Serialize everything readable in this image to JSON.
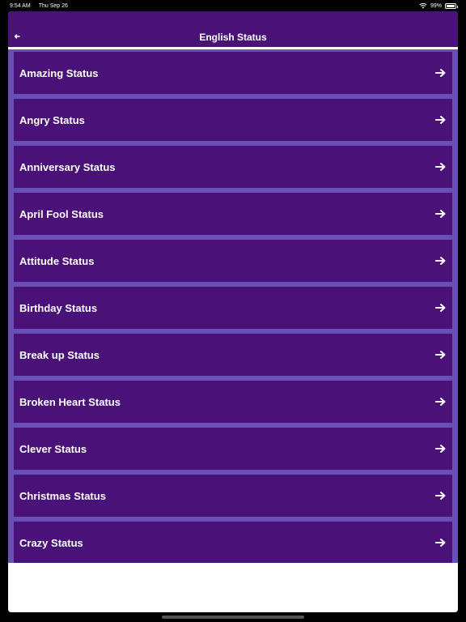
{
  "status_bar": {
    "time": "9:54 AM",
    "date": "Thu Sep 26",
    "battery": "99%"
  },
  "header": {
    "back_icon": "left-arrow-icon",
    "title": "English Status"
  },
  "list": {
    "items": [
      {
        "label": "Amazing Status"
      },
      {
        "label": "Angry Status"
      },
      {
        "label": "Anniversary Status"
      },
      {
        "label": "April Fool Status"
      },
      {
        "label": "Attitude Status"
      },
      {
        "label": "Birthday Status"
      },
      {
        "label": "Break up Status"
      },
      {
        "label": "Broken Heart Status"
      },
      {
        "label": "Clever Status"
      },
      {
        "label": "Christmas Status"
      },
      {
        "label": "Crazy Status"
      }
    ],
    "item_icon": "right-arrow-icon"
  },
  "colors": {
    "header_bg": "#4a1276",
    "list_bg": "#6a4fb6",
    "item_bg": "#4a1178",
    "text": "#ffffff"
  }
}
